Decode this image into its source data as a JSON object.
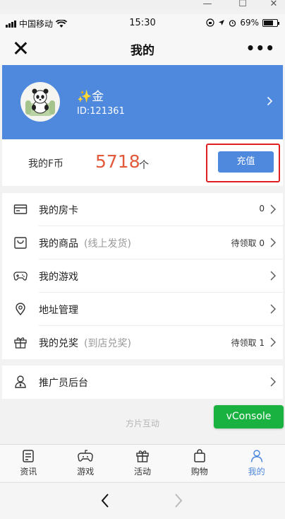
{
  "window_controls": {
    "minimize": "—",
    "maximize": "☐",
    "close": "✕"
  },
  "status_bar": {
    "carrier": "中国移动",
    "time": "15:30",
    "battery": "69%"
  },
  "nav": {
    "title": "我的",
    "more": "•••"
  },
  "profile": {
    "name": "✨金",
    "id_text": "ID:121361"
  },
  "coins": {
    "label": "我的F币",
    "amount": "5718",
    "unit": "个",
    "recharge_label": "充值"
  },
  "menu": {
    "items": [
      {
        "label": "我的房卡",
        "sub": "",
        "value": "0"
      },
      {
        "label": "我的商品",
        "sub": "(线上发货)",
        "value": "待领取 0"
      },
      {
        "label": "我的游戏",
        "sub": "",
        "value": ""
      },
      {
        "label": "地址管理",
        "sub": "",
        "value": ""
      },
      {
        "label": "我的兑奖",
        "sub": "(到店兑奖)",
        "value": "待领取 1"
      }
    ]
  },
  "promoter": {
    "label": "推广员后台"
  },
  "footer": {
    "brand": "方片互动"
  },
  "vconsole": {
    "label": "vConsole"
  },
  "tabbar": {
    "tabs": [
      {
        "label": "资讯"
      },
      {
        "label": "游戏"
      },
      {
        "label": "活动"
      },
      {
        "label": "购物"
      },
      {
        "label": "我的"
      }
    ],
    "active_index": 4
  },
  "colors": {
    "accent": "#4f89dd",
    "amount": "#e25a3a",
    "highlight_frame": "#e02020",
    "vconsole": "#19b13f"
  },
  "icons": {
    "menu": [
      "card-icon",
      "shopping-bag-icon",
      "gamepad-icon",
      "location-pin-icon",
      "gift-icon"
    ],
    "promoter": "user-badge-icon",
    "tabs": [
      "news-icon",
      "game-controller-icon",
      "gift-box-icon",
      "shopping-bag-icon",
      "person-icon"
    ]
  }
}
